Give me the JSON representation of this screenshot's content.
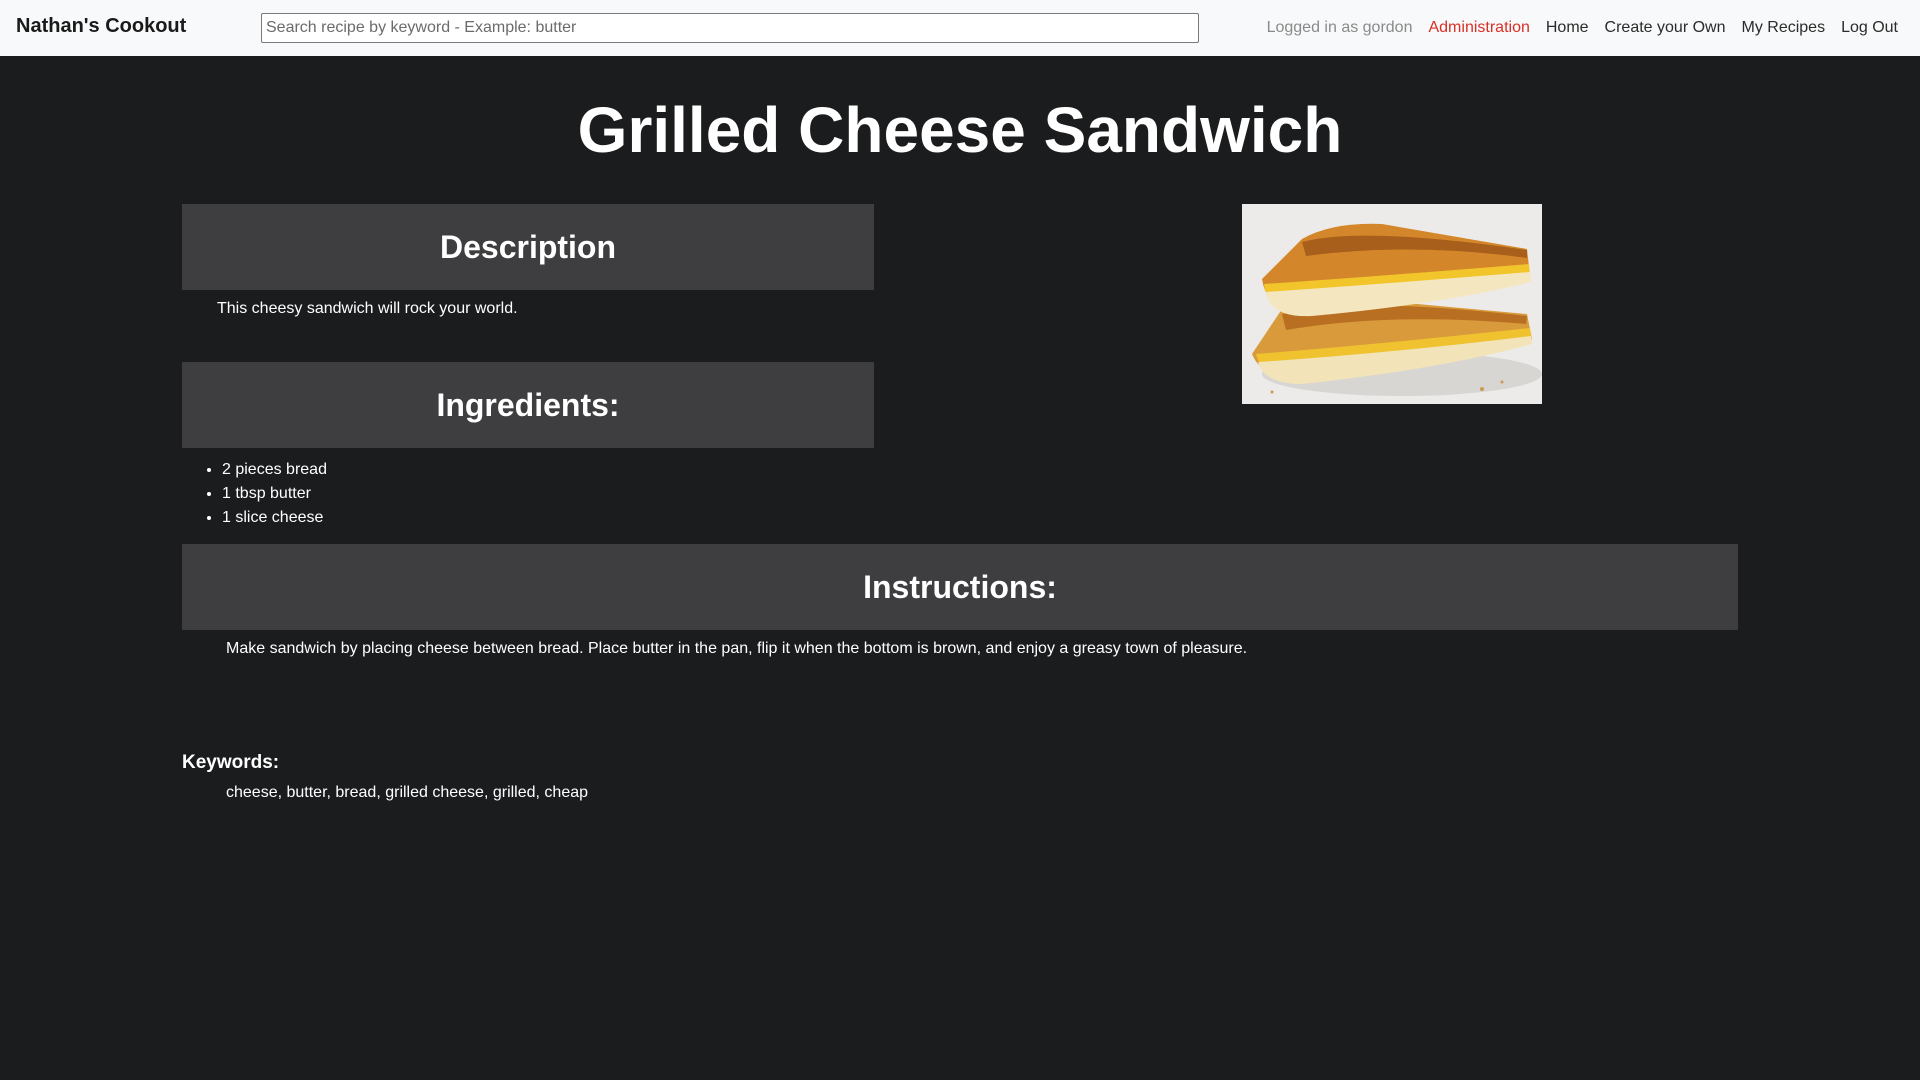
{
  "navbar": {
    "brand": "Nathan's Cookout",
    "search_placeholder": "Search recipe by keyword - Example: butter",
    "logged_in_text": "Logged in as gordon",
    "links": {
      "administration": "Administration",
      "home": "Home",
      "create": "Create your Own",
      "my_recipes": "My Recipes",
      "logout": "Log Out"
    },
    "admin_color": "#d93025"
  },
  "recipe": {
    "title": "Grilled Cheese Sandwich",
    "description_heading": "Description",
    "description": "This cheesy sandwich will rock your world.",
    "ingredients_heading": "Ingredients:",
    "ingredients": [
      "2 pieces bread",
      "1 tbsp butter",
      "1 slice cheese"
    ],
    "instructions_heading": "Instructions:",
    "instructions": "Make sandwich by placing cheese between bread. Place butter in the pan, flip it when the bottom is brown, and enjoy a greasy town of pleasure.",
    "keywords_label": "Keywords:",
    "keywords": "cheese, butter, bread, grilled cheese, grilled, cheap",
    "image_icon": "grilled-cheese-photo"
  },
  "colors": {
    "page_background": "#1b1c1e",
    "section_header": "#3e3e40",
    "navbar_background": "#f8f9fa"
  }
}
